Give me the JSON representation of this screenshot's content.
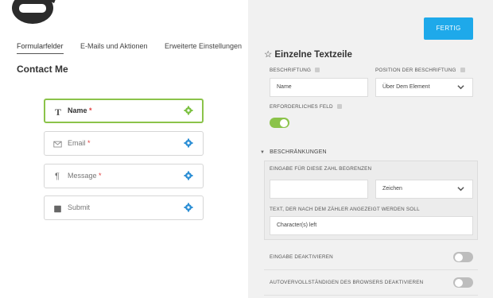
{
  "builder": {
    "tabs": [
      "Formularfelder",
      "E-Mails und Aktionen",
      "Erweiterte Einstellungen"
    ],
    "form_title": "Contact Me",
    "fields": [
      {
        "label": "Name",
        "required_mark": "*",
        "icon": "text-cursor-icon",
        "selected": true
      },
      {
        "label": "Email",
        "required_mark": "*",
        "icon": "envelope-icon",
        "selected": false
      },
      {
        "label": "Message",
        "required_mark": "*",
        "icon": "paragraph-icon",
        "selected": false
      },
      {
        "label": "Submit",
        "required_mark": "",
        "icon": "square-icon",
        "selected": false
      }
    ]
  },
  "drawer": {
    "done_label": "FERTIG",
    "star_glyph": "☆",
    "title": "Einzelne Textzeile",
    "label_caption": "BESCHRIFTUNG",
    "label_value": "Name",
    "label_position_caption": "POSITION DER BESCHRIFTUNG",
    "label_position_value": "Über Dem Element",
    "required_caption": "ERFORDERLICHES FELD",
    "required_on": true,
    "restrictions_header": "BESCHRÄNKUNGEN",
    "limit_caption": "EINGABE FÜR DIESE ZAHL BEGRENZEN",
    "limit_value": "",
    "limit_unit": "Zeichen",
    "counter_text_caption": "TEXT, DER NACH DEM ZÄHLER ANGEZEIGT WERDEN SOLL",
    "counter_text_value": "Character(s) left",
    "disable_input_caption": "EINGABE DEAKTIVIEREN",
    "disable_input_on": false,
    "disable_autocomplete_caption": "AUTOVERVOLLSTÄNDIGEN DES BROWSERS DEAKTIVIEREN",
    "disable_autocomplete_on": false
  },
  "colors": {
    "accent_blue": "#1ea9ea",
    "toggle_on": "#8bc34a",
    "required_star": "#e23c3c",
    "gear_blue": "#2d8fd5",
    "gear_green": "#7cc142"
  }
}
